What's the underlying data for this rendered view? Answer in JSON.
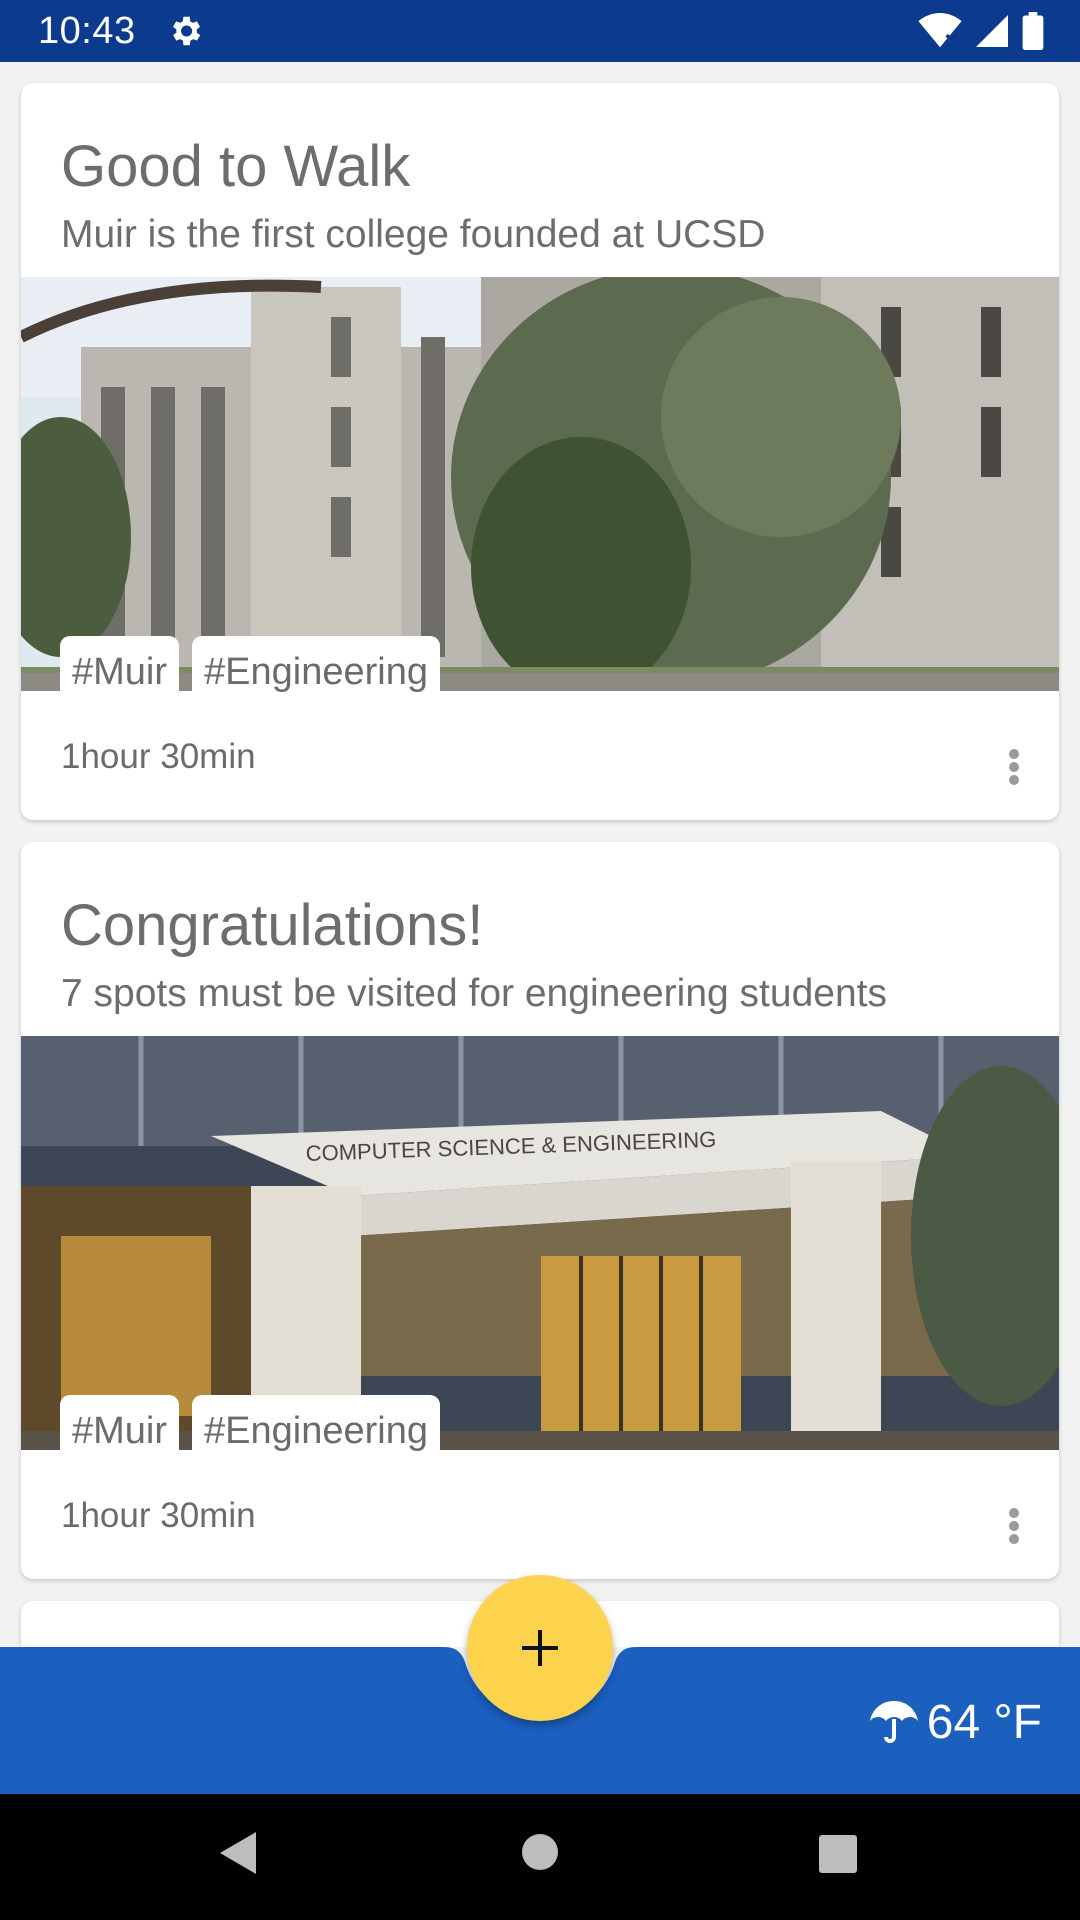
{
  "status_bar": {
    "time": "10:43",
    "icons": [
      "settings-gear-icon",
      "wifi-icon",
      "cellular-signal-icon",
      "battery-icon"
    ]
  },
  "cards": [
    {
      "title": "Good to Walk",
      "subtitle": "Muir is the first college founded at UCSD",
      "image": "muir-college-building-photo",
      "tags": [
        "#Muir",
        "#Engineering"
      ],
      "duration": "1hour 30min"
    },
    {
      "title": "Congratulations!",
      "subtitle": "7 spots must be visited for engineering students",
      "image": "computer-science-engineering-building-photo",
      "image_sign": "COMPUTER SCIENCE & ENGINEERING",
      "tags": [
        "#Muir",
        "#Engineering"
      ],
      "duration": "1hour 30min"
    }
  ],
  "bottom_bar": {
    "weather": "64 °F",
    "weather_icon": "umbrella-icon"
  },
  "fab": {
    "icon": "plus-icon"
  },
  "nav": [
    "back-icon",
    "home-icon",
    "recents-icon"
  ],
  "colors": {
    "status_bar": "#0b3a8f",
    "bottom_bar": "#1b5fbf",
    "fab": "#fdd34e",
    "card_text": "#6d6d6d"
  }
}
